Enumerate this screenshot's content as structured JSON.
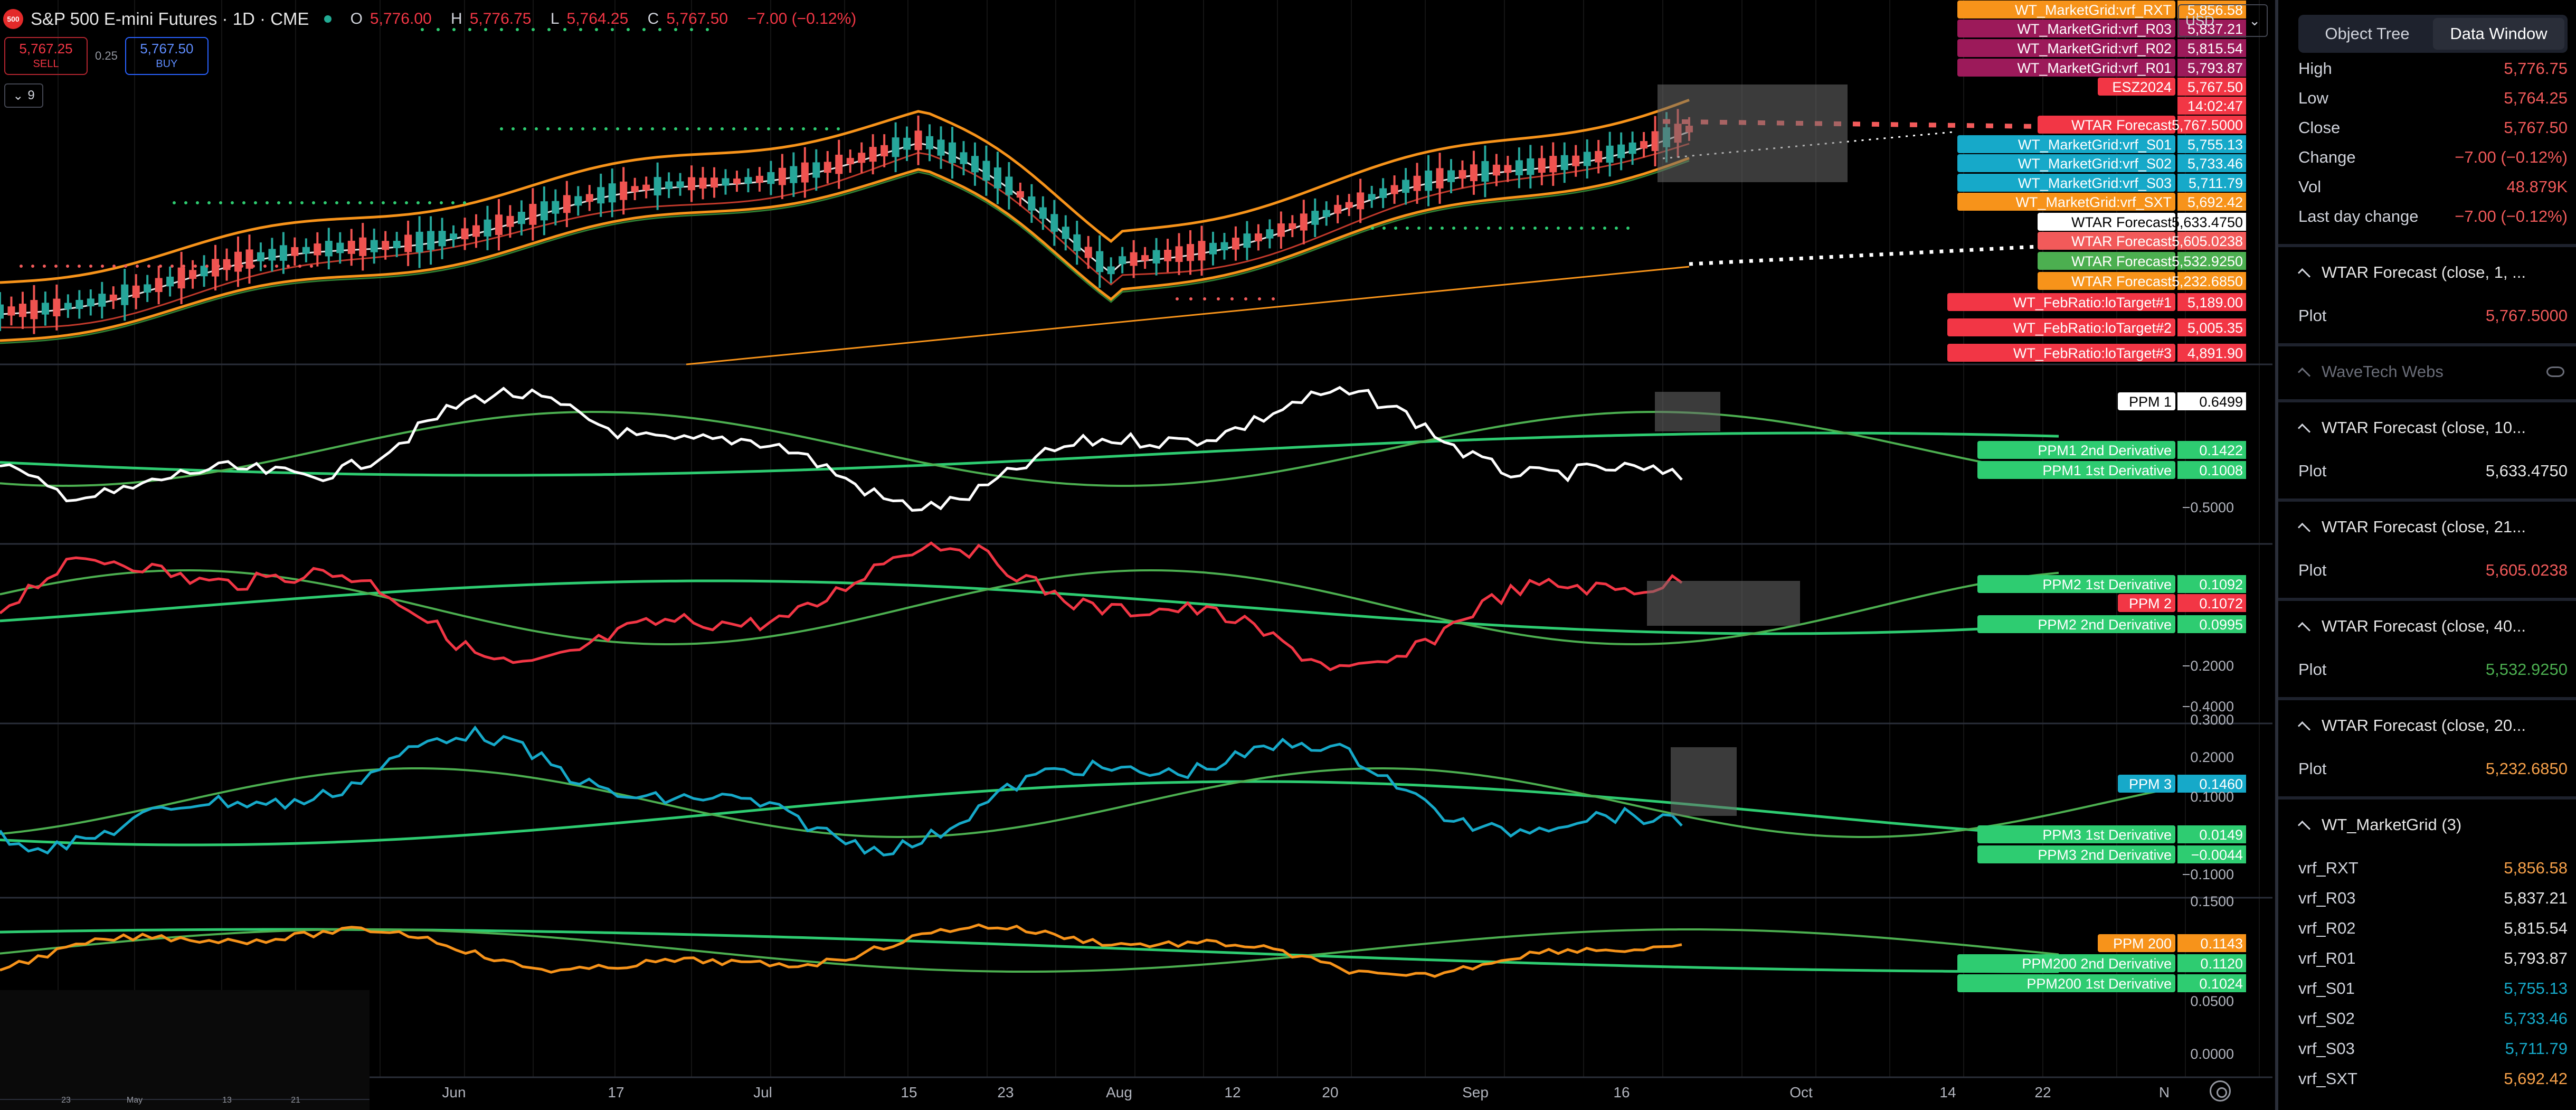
{
  "header": {
    "logo": "500",
    "symbol": "S&P 500 E-mini Futures · 1D · CME",
    "open_label": "O",
    "open": "5,776.00",
    "high_label": "H",
    "high": "5,776.75",
    "low_label": "L",
    "low": "5,764.25",
    "close_label": "C",
    "close": "5,767.50",
    "change": "−7.00 (−0.12%)"
  },
  "trade": {
    "sell_price": "5,767.25",
    "sell_label": "SELL",
    "spread": "0.25",
    "buy_price": "5,767.50",
    "buy_label": "BUY"
  },
  "indicators_count": "9",
  "currency": "USD",
  "price_labels": [
    {
      "text": "WT_MarketGrid:vrf_RXT",
      "value": "5,856.58",
      "color": "#f7931a"
    },
    {
      "text": "WT_MarketGrid:vrf_R03",
      "value": "5,837.21",
      "color": "#9c1a5a"
    },
    {
      "text": "WT_MarketGrid:vrf_R02",
      "value": "5,815.54",
      "color": "#9c1a5a"
    },
    {
      "text": "WT_MarketGrid:vrf_R01",
      "value": "5,793.87",
      "color": "#9c1a5a"
    },
    {
      "text": "ESZ2024",
      "value": "5,767.50",
      "color": "#f23645"
    },
    {
      "text": "",
      "value": "14:02:47",
      "color": "#f23645"
    },
    {
      "text": "WTAR Forecast",
      "value": "5,767.5000",
      "color": "#f23645"
    },
    {
      "text": "WT_MarketGrid:vrf_S01",
      "value": "5,755.13",
      "color": "#16a9c9"
    },
    {
      "text": "WT_MarketGrid:vrf_S02",
      "value": "5,733.46",
      "color": "#16a9c9"
    },
    {
      "text": "WT_MarketGrid:vrf_S03",
      "value": "5,711.79",
      "color": "#16a9c9"
    },
    {
      "text": "WT_MarketGrid:vrf_SXT",
      "value": "5,692.42",
      "color": "#f7931a"
    },
    {
      "text": "WTAR Forecast",
      "value": "5,633.4750",
      "color": "#ffffff"
    },
    {
      "text": "WTAR Forecast",
      "value": "5,605.0238",
      "color": "#f25a5a"
    },
    {
      "text": "WTAR Forecast",
      "value": "5,532.9250",
      "color": "#4caf50"
    },
    {
      "text": "WTAR Forecast",
      "value": "5,232.6850",
      "color": "#f7931a"
    },
    {
      "text": "WT_FebRatio:loTarget#1",
      "value": "5,189.00",
      "color": "#f23645"
    },
    {
      "text": "WT_FebRatio:loTarget#2",
      "value": "5,005.35",
      "color": "#f23645"
    },
    {
      "text": "WT_FebRatio:loTarget#3",
      "value": "4,891.90",
      "color": "#f23645"
    }
  ],
  "pane_labels": [
    {
      "text": "PPM 1",
      "value": "0.6499",
      "color": "#ffffff"
    },
    {
      "text": "PPM1 2nd Derivative",
      "value": "0.1422",
      "color": "#2ecc71"
    },
    {
      "text": "PPM1 1st Derivative",
      "value": "0.1008",
      "color": "#2ecc71"
    },
    {
      "text": "PPM2 1st Derivative",
      "value": "0.1092",
      "color": "#2ecc71"
    },
    {
      "text": "PPM 2",
      "value": "0.1072",
      "color": "#f23645"
    },
    {
      "text": "PPM2 2nd Derivative",
      "value": "0.0995",
      "color": "#2ecc71"
    },
    {
      "text": "PPM 3",
      "value": "0.1460",
      "color": "#16a9c9"
    },
    {
      "text": "PPM3 1st Derivative",
      "value": "0.0149",
      "color": "#2ecc71"
    },
    {
      "text": "PPM3 2nd Derivative",
      "value": "−0.0044",
      "color": "#2ecc71"
    },
    {
      "text": "PPM 200",
      "value": "0.1143",
      "color": "#f7931a"
    },
    {
      "text": "PPM200 2nd Derivative",
      "value": "0.1120",
      "color": "#2ecc71"
    },
    {
      "text": "PPM200 1st Derivative",
      "value": "0.1024",
      "color": "#2ecc71"
    }
  ],
  "axis_ticks": [
    {
      "text": "−0.5000"
    },
    {
      "text": "−0.2000"
    },
    {
      "text": "−0.4000"
    },
    {
      "text": "0.3000"
    },
    {
      "text": "0.2000"
    },
    {
      "text": "0.1000"
    },
    {
      "text": "−0.1000"
    },
    {
      "text": "0.1500"
    },
    {
      "text": "0.0500"
    },
    {
      "text": "0.0000"
    }
  ],
  "time_axis": [
    "Jun",
    "17",
    "Jul",
    "15",
    "23",
    "Aug",
    "12",
    "20",
    "Sep",
    "16",
    "Oct",
    "14",
    "22",
    "N"
  ],
  "mini_axis": [
    "23",
    "May",
    "13",
    "21"
  ],
  "panel": {
    "tabs": [
      "Object Tree",
      "Data Window"
    ],
    "active_tab": "Data Window",
    "rows": [
      {
        "label": "High",
        "value": "5,776.75",
        "color": "#f25a5a"
      },
      {
        "label": "Low",
        "value": "5,764.25",
        "color": "#f25a5a"
      },
      {
        "label": "Close",
        "value": "5,767.50",
        "color": "#f25a5a"
      },
      {
        "label": "Change",
        "value": "−7.00 (−0.12%)",
        "color": "#f25a5a"
      },
      {
        "label": "Vol",
        "value": "48.879K",
        "color": "#f25a5a"
      },
      {
        "label": "Last day change",
        "value": "−7.00 (−0.12%)",
        "color": "#f25a5a"
      }
    ],
    "sections": [
      {
        "title": "WTAR Forecast (close, 1, ...",
        "plot_label": "Plot",
        "plot_value": "5,767.5000",
        "color": "#f25a5a"
      },
      {
        "title": "WaveTech Webs",
        "hidden": true
      },
      {
        "title": "WTAR Forecast (close, 10...",
        "plot_label": "Plot",
        "plot_value": "5,633.4750",
        "color": "#e6e6e6"
      },
      {
        "title": "WTAR Forecast (close, 21...",
        "plot_label": "Plot",
        "plot_value": "5,605.0238",
        "color": "#f25a5a"
      },
      {
        "title": "WTAR Forecast (close, 40...",
        "plot_label": "Plot",
        "plot_value": "5,532.9250",
        "color": "#4caf50"
      },
      {
        "title": "WTAR Forecast (close, 20...",
        "plot_label": "Plot",
        "plot_value": "5,232.6850",
        "color": "#f7a14a"
      }
    ],
    "grid_title": "WT_MarketGrid (3)",
    "grid": [
      {
        "label": "vrf_RXT",
        "value": "5,856.58",
        "color": "#f7a14a"
      },
      {
        "label": "vrf_R03",
        "value": "5,837.21",
        "color": "#e6e6e6"
      },
      {
        "label": "vrf_R02",
        "value": "5,815.54",
        "color": "#e6e6e6"
      },
      {
        "label": "vrf_R01",
        "value": "5,793.87",
        "color": "#e6e6e6"
      },
      {
        "label": "vrf_S01",
        "value": "5,755.13",
        "color": "#16a9c9"
      },
      {
        "label": "vrf_S02",
        "value": "5,733.46",
        "color": "#16a9c9"
      },
      {
        "label": "vrf_S03",
        "value": "5,711.79",
        "color": "#16a9c9"
      },
      {
        "label": "vrf_SXT",
        "value": "5,692.42",
        "color": "#f7a14a"
      }
    ]
  }
}
